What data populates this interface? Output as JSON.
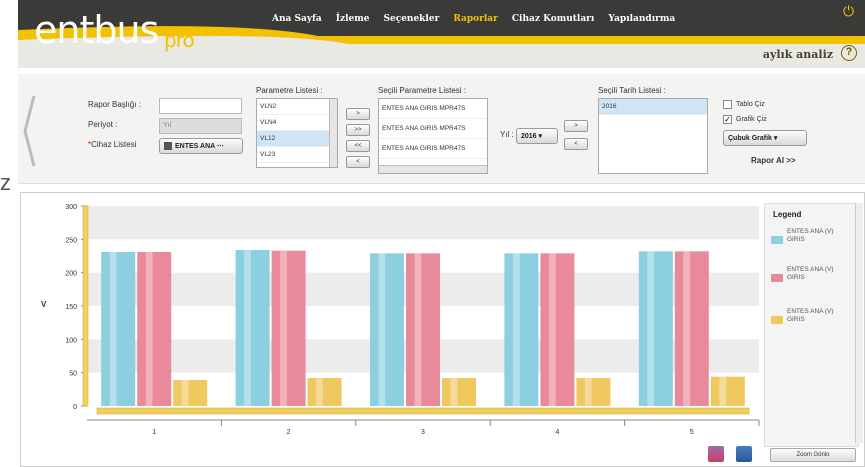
{
  "header": {
    "logo_main": "entbus",
    "logo_suffix": "pro",
    "nav": [
      "Ana Sayfa",
      "İzleme",
      "Seçenekler",
      "Raporlar",
      "Cihaz Komutları",
      "Yapılandırma"
    ],
    "active_nav": "Raporlar",
    "subtitle": "aylık analiz",
    "help_glyph": "?",
    "power_glyph": "⏻"
  },
  "form": {
    "rapor_basligi_label": "Rapor Başlığı :",
    "rapor_basligi_value": "",
    "periyot_label": "Periyot :",
    "periyot_value": "Yıl",
    "cihaz_label": "Cihaz Listesi",
    "cihaz_required": "*",
    "cihaz_value": "ENTES ANA ⋯",
    "parametre_listesi_label": "Parametre Listesi :",
    "parametre_items": [
      "VLN2",
      "VLN4",
      "VL12",
      "VL23"
    ],
    "parametre_selected": "VL12",
    "move_buttons": [
      ">",
      ">>",
      "<<",
      "<"
    ],
    "secili_parametre_label": "Seçili Parametre Listesi :",
    "secili_parametre_items": [
      "ENTES ANA GIRIS MPR47S",
      "ENTES ANA GIRIS MPR47S",
      "ENTES ANA GIRIS MPR47S"
    ],
    "yil_label": "Yıl :",
    "yil_value": "2016",
    "date_move_buttons": [
      ">",
      "<"
    ],
    "secili_tarih_label": "Seçili Tarih Listesi :",
    "secili_tarih_items": [
      "2016"
    ],
    "tablo_ciz_label": "Tablo Çiz",
    "tablo_ciz_checked": false,
    "grafik_ciz_label": "Grafik Çiz",
    "grafik_ciz_checked": true,
    "grafik_tipi_value": "Çubuk Grafik",
    "rapor_al_label": "Rapor Al >>"
  },
  "side_letter": "z",
  "legend": {
    "title": "Legend",
    "items": [
      {
        "label": "ENTES ANA (V) GIRIS",
        "color": "#8ccfe0"
      },
      {
        "label": "ENTES ANA (V) GIRIS",
        "color": "#e88a9a"
      },
      {
        "label": "ENTES ANA (V) GIRIS",
        "color": "#f0c860"
      }
    ]
  },
  "zoom_label": "Zoom Gönlo",
  "chart_data": {
    "type": "bar",
    "categories": [
      "1",
      "2",
      "3",
      "4",
      "5"
    ],
    "series": [
      {
        "name": "ENTES ANA (V) GIRIS",
        "color": "#8ccfe0",
        "values": [
          231,
          234,
          229,
          229,
          232
        ]
      },
      {
        "name": "ENTES ANA (V) GIRIS",
        "color": "#e88a9a",
        "values": [
          231,
          233,
          229,
          229,
          232
        ]
      },
      {
        "name": "ENTES ANA (V) GIRIS",
        "color": "#f0c860",
        "values": [
          39,
          42,
          42,
          42,
          44
        ]
      }
    ],
    "ylabel": "V",
    "ylim": [
      0,
      300
    ],
    "yticks": [
      0,
      50,
      100,
      150,
      200,
      250,
      300
    ],
    "grid": true
  }
}
